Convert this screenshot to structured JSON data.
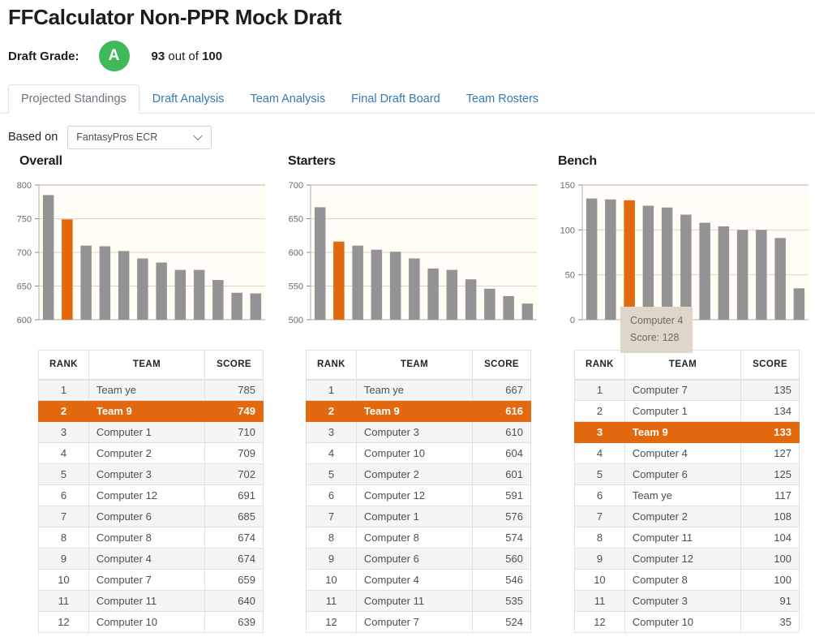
{
  "header": {
    "title": "FFCalculator Non-PPR Mock Draft",
    "grade_label": "Draft Grade:",
    "grade_letter": "A",
    "grade_value": "93",
    "grade_out_of_word": "out of",
    "grade_max": "100",
    "grade_color": "#3fb95a"
  },
  "tabs": [
    {
      "label": "Projected Standings",
      "active": true
    },
    {
      "label": "Draft Analysis",
      "active": false
    },
    {
      "label": "Team Analysis",
      "active": false
    },
    {
      "label": "Final Draft Board",
      "active": false
    },
    {
      "label": "Team Rosters",
      "active": false
    }
  ],
  "based_on": {
    "label": "Based on",
    "selected": "FantasyPros ECR",
    "options": [
      "FantasyPros ECR"
    ]
  },
  "theme": {
    "accent": "#e2690d",
    "bar_gray": "#939393",
    "chart_bg": "#fffdf5",
    "grid": "#d9d5cb",
    "tooltip_bg": "#ded6c8",
    "link_blue": "#337ab7"
  },
  "table_columns": [
    "RANK",
    "TEAM",
    "SCORE"
  ],
  "tooltip": {
    "visible": true,
    "chart": "bench",
    "team": "Computer 4",
    "score_label": "Score:",
    "score": "128"
  },
  "chart_data": [
    {
      "id": "overall",
      "type": "bar",
      "title": "Overall",
      "xlabel": "",
      "ylabel": "",
      "ylim": [
        600,
        800
      ],
      "yticks": [
        600,
        650,
        700,
        750,
        800
      ],
      "grid": true,
      "legend": "none",
      "categories": [
        "Team ye",
        "Team 9",
        "Computer 1",
        "Computer 2",
        "Computer 3",
        "Computer 12",
        "Computer 6",
        "Computer 8",
        "Computer 4",
        "Computer 7",
        "Computer 11",
        "Computer 10"
      ],
      "values": [
        785,
        749,
        710,
        709,
        702,
        691,
        685,
        674,
        674,
        659,
        640,
        639
      ],
      "highlight_index": 1
    },
    {
      "id": "starters",
      "type": "bar",
      "title": "Starters",
      "xlabel": "",
      "ylabel": "",
      "ylim": [
        500,
        700
      ],
      "yticks": [
        500,
        550,
        600,
        650,
        700
      ],
      "grid": true,
      "legend": "none",
      "categories": [
        "Team ye",
        "Team 9",
        "Computer 3",
        "Computer 10",
        "Computer 2",
        "Computer 12",
        "Computer 1",
        "Computer 8",
        "Computer 6",
        "Computer 4",
        "Computer 11",
        "Computer 7"
      ],
      "values": [
        667,
        616,
        610,
        604,
        601,
        591,
        576,
        574,
        560,
        546,
        535,
        524
      ],
      "highlight_index": 1
    },
    {
      "id": "bench",
      "type": "bar",
      "title": "Bench",
      "xlabel": "",
      "ylabel": "",
      "ylim": [
        0,
        150
      ],
      "yticks": [
        0,
        50,
        100,
        150
      ],
      "grid": true,
      "legend": "none",
      "categories": [
        "Computer 7",
        "Computer 1",
        "Team 9",
        "Computer 4",
        "Computer 6",
        "Team ye",
        "Computer 2",
        "Computer 11",
        "Computer 12",
        "Computer 8",
        "Computer 3",
        "Computer 10"
      ],
      "values": [
        135,
        134,
        133,
        127,
        125,
        117,
        108,
        104,
        100,
        100,
        91,
        35
      ],
      "highlight_index": 2
    }
  ],
  "tables": [
    {
      "id": "overall",
      "highlight_rank": 2,
      "rows": [
        {
          "rank": "1",
          "team": "Team ye",
          "score": "785"
        },
        {
          "rank": "2",
          "team": "Team 9",
          "score": "749"
        },
        {
          "rank": "3",
          "team": "Computer 1",
          "score": "710"
        },
        {
          "rank": "4",
          "team": "Computer 2",
          "score": "709"
        },
        {
          "rank": "5",
          "team": "Computer 3",
          "score": "702"
        },
        {
          "rank": "6",
          "team": "Computer 12",
          "score": "691"
        },
        {
          "rank": "7",
          "team": "Computer 6",
          "score": "685"
        },
        {
          "rank": "8",
          "team": "Computer 8",
          "score": "674"
        },
        {
          "rank": "9",
          "team": "Computer 4",
          "score": "674"
        },
        {
          "rank": "10",
          "team": "Computer 7",
          "score": "659"
        },
        {
          "rank": "11",
          "team": "Computer 11",
          "score": "640"
        },
        {
          "rank": "12",
          "team": "Computer 10",
          "score": "639"
        }
      ]
    },
    {
      "id": "starters",
      "highlight_rank": 2,
      "rows": [
        {
          "rank": "1",
          "team": "Team ye",
          "score": "667"
        },
        {
          "rank": "2",
          "team": "Team 9",
          "score": "616"
        },
        {
          "rank": "3",
          "team": "Computer 3",
          "score": "610"
        },
        {
          "rank": "4",
          "team": "Computer 10",
          "score": "604"
        },
        {
          "rank": "5",
          "team": "Computer 2",
          "score": "601"
        },
        {
          "rank": "6",
          "team": "Computer 12",
          "score": "591"
        },
        {
          "rank": "7",
          "team": "Computer 1",
          "score": "576"
        },
        {
          "rank": "8",
          "team": "Computer 8",
          "score": "574"
        },
        {
          "rank": "9",
          "team": "Computer 6",
          "score": "560"
        },
        {
          "rank": "10",
          "team": "Computer 4",
          "score": "546"
        },
        {
          "rank": "11",
          "team": "Computer 11",
          "score": "535"
        },
        {
          "rank": "12",
          "team": "Computer 7",
          "score": "524"
        }
      ]
    },
    {
      "id": "bench",
      "highlight_rank": 3,
      "rows": [
        {
          "rank": "1",
          "team": "Computer 7",
          "score": "135"
        },
        {
          "rank": "2",
          "team": "Computer 1",
          "score": "134"
        },
        {
          "rank": "3",
          "team": "Team 9",
          "score": "133"
        },
        {
          "rank": "4",
          "team": "Computer 4",
          "score": "127"
        },
        {
          "rank": "5",
          "team": "Computer 6",
          "score": "125"
        },
        {
          "rank": "6",
          "team": "Team ye",
          "score": "117"
        },
        {
          "rank": "7",
          "team": "Computer 2",
          "score": "108"
        },
        {
          "rank": "8",
          "team": "Computer 11",
          "score": "104"
        },
        {
          "rank": "9",
          "team": "Computer 12",
          "score": "100"
        },
        {
          "rank": "10",
          "team": "Computer 8",
          "score": "100"
        },
        {
          "rank": "11",
          "team": "Computer 3",
          "score": "91"
        },
        {
          "rank": "12",
          "team": "Computer 10",
          "score": "35"
        }
      ]
    }
  ]
}
